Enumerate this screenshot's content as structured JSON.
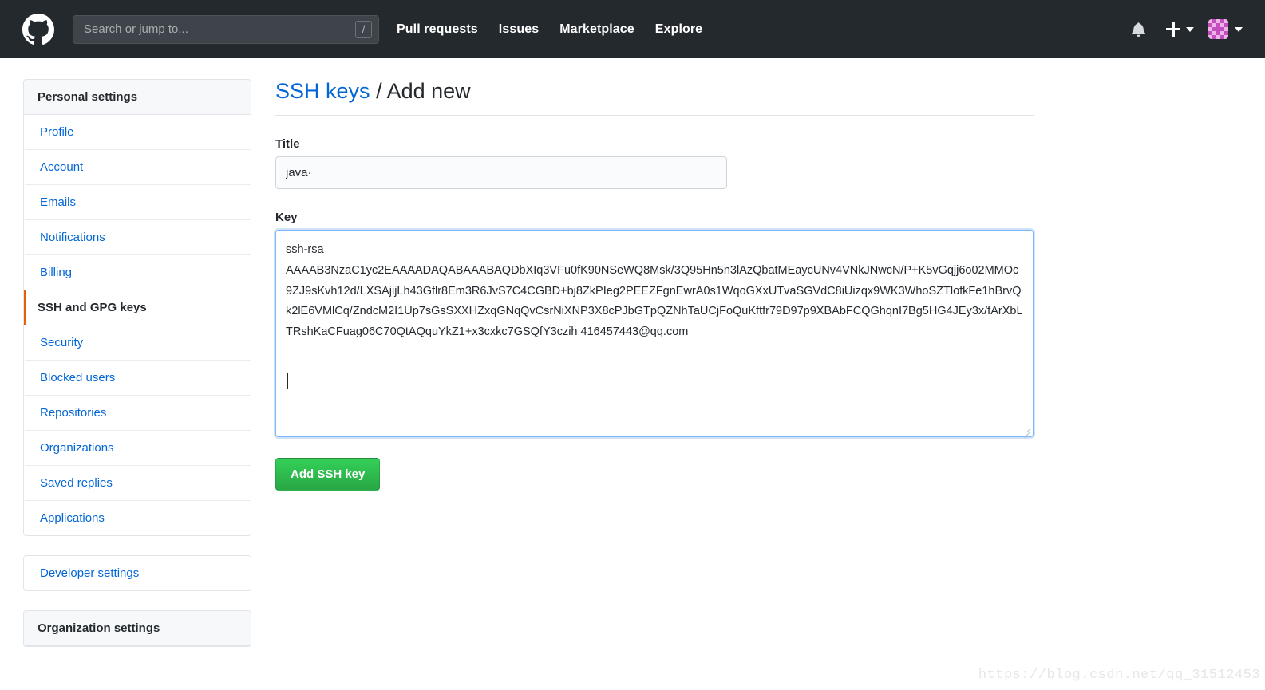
{
  "header": {
    "logo_icon": "github-mark-icon",
    "search": {
      "placeholder": "Search or jump to...",
      "value": "",
      "shortcut_badge": "/"
    },
    "nav": [
      {
        "label": "Pull requests"
      },
      {
        "label": "Issues"
      },
      {
        "label": "Marketplace"
      },
      {
        "label": "Explore"
      }
    ],
    "notifications_icon": "bell-icon",
    "create_new_icon": "plus-icon",
    "create_new_caret_icon": "caret-down-icon",
    "avatar_icon": "user-avatar-identicon",
    "avatar_caret_icon": "caret-down-icon",
    "background_color": "#24292e"
  },
  "sidebar": {
    "personal": {
      "heading": "Personal settings",
      "items": [
        {
          "label": "Profile",
          "selected": false
        },
        {
          "label": "Account",
          "selected": false
        },
        {
          "label": "Emails",
          "selected": false
        },
        {
          "label": "Notifications",
          "selected": false
        },
        {
          "label": "Billing",
          "selected": false
        },
        {
          "label": "SSH and GPG keys",
          "selected": true
        },
        {
          "label": "Security",
          "selected": false
        },
        {
          "label": "Blocked users",
          "selected": false
        },
        {
          "label": "Repositories",
          "selected": false
        },
        {
          "label": "Organizations",
          "selected": false
        },
        {
          "label": "Saved replies",
          "selected": false
        },
        {
          "label": "Applications",
          "selected": false
        }
      ]
    },
    "developer": {
      "label": "Developer settings"
    },
    "organization": {
      "heading": "Organization settings"
    },
    "selected_accent_color": "#e36209",
    "link_color": "#0366d6"
  },
  "main": {
    "title_link": "SSH keys",
    "title_separator": "/",
    "title_current": "Add new",
    "title_field": {
      "label": "Title",
      "value": "java·"
    },
    "key_field": {
      "label": "Key",
      "value": "ssh-rsa\nAAAAB3NzaC1yc2EAAAADAQABAAABAQDbXIq3VFu0fK90NSeWQ8Msk/3Q95Hn5n3lAzQbatMEaycUNv4VNkJNwcN/P+K5vGqjj6o02MMOc9ZJ9sKvh12d/LXSAjijLh43Gflr8Em3R6JvS7C4CGBD+bj8ZkPIeg2PEEZFgnEwrA0s1WqoGXxUTvaSGVdC8iUizqx9WK3WhoSZTlofkFe1hBrvQk2lE6VMlCq/ZndcM2I1Up7sGsSXXHZxqGNqQvCsrNiXNP3X8cPJbGTpQZNhTaUCjFoQuKftfr79D97p9XBAbFCQGhqnI7Bg5HG4JEy3x/fArXbLTRshKaCFuag06C70QtAQquYkZ1+x3cxkc7GSQfY3czih 416457443@qq.com\n"
    },
    "submit_label": "Add SSH key",
    "submit_color": "#28a745"
  },
  "watermark": {
    "text": "https://blog.csdn.net/qq_31512453"
  }
}
